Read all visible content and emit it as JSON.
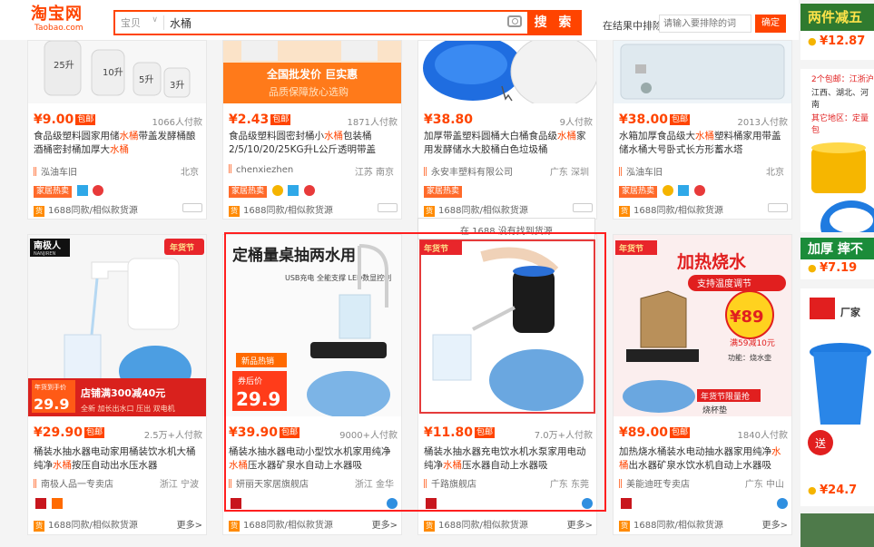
{
  "header": {
    "logo_cn": "淘宝网",
    "logo_en": "Taobao.com",
    "search_scope": "宝贝",
    "search_query": "水桶",
    "search_button": "搜 索",
    "filter_label": "在结果中排除",
    "filter_placeholder": "请输入要排除的词",
    "filter_button": "确定"
  },
  "row1": [
    {
      "price": "¥9.00",
      "tag": "包邮",
      "paid": "1066人付款",
      "title_a": "食品级塑料圆家用储",
      "title_hl": "水桶",
      "title_b": "带盖发酵桶酿酒桶密封桶加厚大",
      "title_hl2": "水桶",
      "shop": "泓油车旧",
      "loc": "北京",
      "bottom": "1688同款/相似款货源",
      "label_img": [
        "25升",
        "10升",
        "5升",
        "3升"
      ]
    },
    {
      "price": "¥2.43",
      "tag": "包邮",
      "paid": "1871人付款",
      "title_a": "食品级塑料圆密封桶小",
      "title_hl": "水桶",
      "title_b": "包装桶2/5/10/20/25KG升L公斤透明带盖",
      "title_hl2": "",
      "shop": "chenxiezhen",
      "loc": "江苏 南京",
      "bottom": "1688同款/相似款货源",
      "banner1": "全国批发价 巨实惠",
      "banner2": "品质保障放心选购"
    },
    {
      "price": "¥38.80",
      "tag": "",
      "paid": "9人付款",
      "title_a": "加厚带盖塑料圆桶大白桶食品级",
      "title_hl": "水桶",
      "title_b": "家用发酵储水大胶桶白色垃圾桶",
      "title_hl2": "",
      "shop": "永安丰塑料有限公司",
      "loc": "广东 深圳",
      "bottom": "1688同款/相似款货源"
    },
    {
      "price": "¥38.00",
      "tag": "包邮",
      "paid": "2013人付款",
      "title_a": "水箱加厚食品级大",
      "title_hl": "水桶",
      "title_b": "塑料桶家用带盖储水桶大号卧式长方形蓄水塔",
      "title_hl2": "",
      "shop": "泓油车旧",
      "loc": "北京",
      "bottom": "1688同款/相似款货源"
    }
  ],
  "tooltip": "在 1688 没有找到货源",
  "row2": [
    {
      "price": "¥29.90",
      "tag": "包邮",
      "paid": "2.5万+人付款",
      "title_a": "桶装水抽水器电动家用桶装饮水机大桶纯净",
      "title_hl": "水桶",
      "title_b": "按压自动出水压水器",
      "shop": "南极人品一专卖店",
      "loc": "浙江 宁波",
      "bottom": "1688同款/相似款货源",
      "more": "更多>",
      "brand": "南极人",
      "brand_en": "NANJIREN",
      "nian": "年货节",
      "promo_price": "29.9",
      "promo_price_label": "年货到手价",
      "coupon": "店铺满300减40元",
      "coupon2": "全新 加长出水口 压出 双电机"
    },
    {
      "price": "¥39.90",
      "tag": "包邮",
      "paid": "9000+人付款",
      "title_a": "桶装水抽水器电动小型饮水机家用纯净",
      "title_hl": "水桶",
      "title_b": "压水器矿泉水自动上水器吸",
      "shop": "妍丽天家居旗舰店",
      "loc": "浙江 金华",
      "bottom": "1688同款/相似款货源",
      "more": "更多>",
      "big_text": "定桶量桌抽两水用",
      "vert": "USB充电 全能支撑 LED数显控制",
      "coupon_label": "新品热销",
      "coupon_text": "券后价",
      "coupon_price": "29.9"
    },
    {
      "price": "¥11.80",
      "tag": "包邮",
      "paid": "7.0万+人付款",
      "title_a": "桶装水抽水器充电饮水机水泵家用电动纯净",
      "title_hl": "水桶",
      "title_b": "压水器自动上水器吸",
      "shop": "千路旗舰店",
      "loc": "广东 东莞",
      "bottom": "1688同款/相似款货源",
      "more": "更多>",
      "nian": "年货节"
    },
    {
      "price": "¥89.00",
      "tag": "包邮",
      "paid": "1840人付款",
      "title_a": "加热烧水桶装水电动抽水器家用纯净",
      "title_hl": "水桶",
      "title_b": "出水器矿泉水饮水机自动上水器吸",
      "shop": "美能迪旺专卖店",
      "loc": "广东 中山",
      "bottom": "1688同款/相似款货源",
      "more": "更多>",
      "nian": "年货节",
      "headline": "加热烧水",
      "sub": "支持温度调节",
      "price_big": "¥89",
      "price_note": "满59减10元",
      "feat": "功能：烧水壶",
      "limit": "年货节限量抢",
      "bottom_label": "烧杯垫"
    }
  ],
  "ads": [
    {
      "head": "两件减五",
      "price": "¥12.87"
    },
    {
      "line1": "2个包邮：江浙沪",
      "line2": "江西、湖北、河南",
      "line3": "其它地区：定量包"
    },
    {
      "head": "加厚 摔不",
      "price": "¥7.19"
    },
    {
      "head": "厂家",
      "price": "¥24.7",
      "label": "送"
    }
  ],
  "colors": {
    "accent": "#ff4400",
    "highlight": "#ff1f1f"
  }
}
